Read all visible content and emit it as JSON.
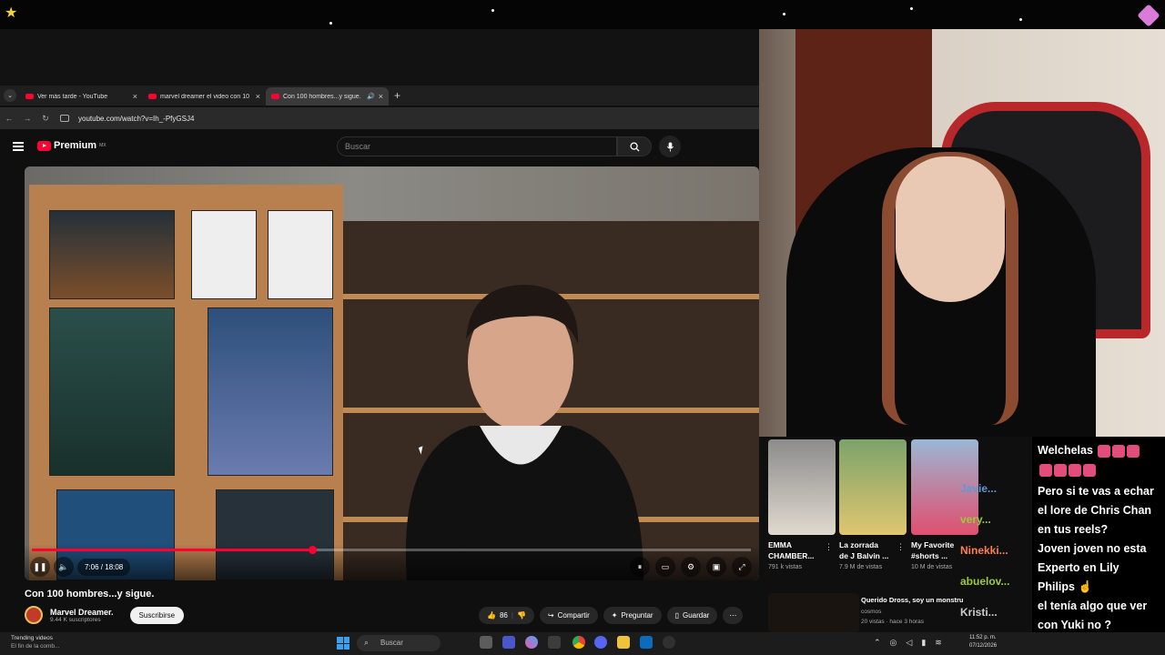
{
  "browser": {
    "tabs": [
      {
        "title": "Ver más tarde - YouTube",
        "active": false
      },
      {
        "title": "marvel dreamer el video con 10",
        "active": false
      },
      {
        "title": "Con 100 hombres...y sigue.",
        "active": true
      }
    ],
    "new_tab": "+",
    "url": "youtube.com/watch?v=Ih_-PfyGSJ4"
  },
  "youtube": {
    "logo": "Premium",
    "region": "MX",
    "search_placeholder": "Buscar",
    "video": {
      "progress": 0.39,
      "time": "7:06 / 18:08",
      "title": "Con 100 hombres...y sigue."
    },
    "channel": {
      "name": "Marvel Dreamer.",
      "subs": "9.44 K suscriptores",
      "subscribe": "Suscribirse"
    },
    "actions": {
      "likes": "86",
      "share": "Compartir",
      "ask": "Preguntar",
      "save": "Guardar"
    }
  },
  "related": [
    {
      "title1": "EMMA",
      "title2": "CHAMBER...",
      "views": "791 k vistas"
    },
    {
      "title1": "La zorrada",
      "title2": "de J Balvin ...",
      "views": "7.9 M de vistas"
    },
    {
      "title1": "My Favorite",
      "title2": "#shorts ...",
      "views": "10 M de vistas"
    }
  ],
  "related_row": {
    "title": "Querido Dross, soy un monstru",
    "channel": "cosmos",
    "meta": "20 vistas · hace 3 horas"
  },
  "chat_users": [
    {
      "name": "Javie...",
      "color": "#5b9bd5"
    },
    {
      "name": "very...",
      "color": "#9acd32"
    },
    {
      "name": "Ninekki...",
      "color": "#ff7f50"
    },
    {
      "name": "abuelov...",
      "color": "#9acd32"
    },
    {
      "name": "Kristi...",
      "color": "#cccccc"
    }
  ],
  "chat": {
    "user": "Welchelas",
    "lines": [
      "Pero si te vas a echar",
      "el lore de Chris Chan",
      "en tus reels?",
      "Joven joven no esta",
      "Experto en Lily",
      "Philips",
      "el tenía algo que ver",
      "con Yuki no ?"
    ]
  },
  "taskbar": {
    "trend_title": "Trending videos",
    "trend_sub": "El fin de la comb...",
    "search": "Buscar",
    "time": "11:52 p. m.",
    "date": "07/12/2026"
  },
  "colors": {
    "accent": "#ff0033",
    "background": "#0f0f0f"
  }
}
